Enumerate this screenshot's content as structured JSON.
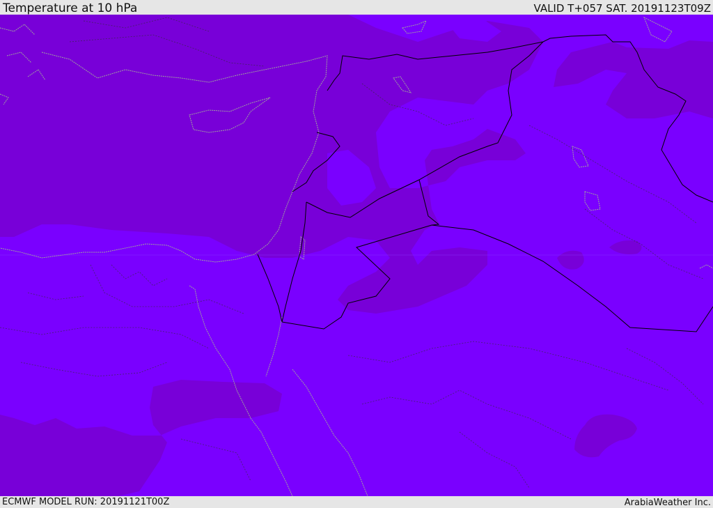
{
  "header": {
    "title": "Temperature at 10 hPa",
    "valid_time": "VALID T+057 SAT. 20191123T09Z"
  },
  "footer": {
    "model_run": "ECMWF MODEL RUN: 20191121T00Z",
    "credit": "ArabiaWeather Inc."
  },
  "map": {
    "layers": [
      {
        "name": "cold-zone",
        "color": "#7800d8"
      },
      {
        "name": "warm-zone",
        "color": "#7a00ff"
      }
    ],
    "coastline_color": "#a0a0a0",
    "border_color": "#000000"
  }
}
